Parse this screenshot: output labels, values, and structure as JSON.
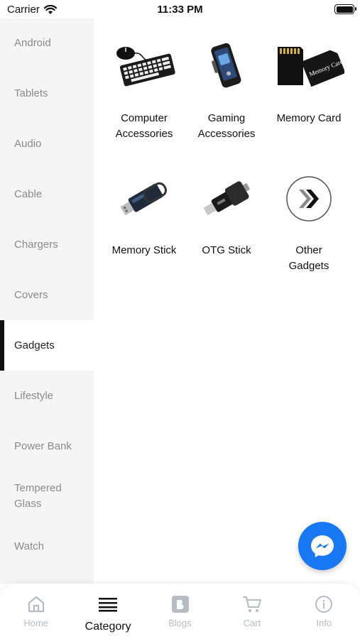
{
  "status_bar": {
    "carrier": "Carrier",
    "time": "11:33 PM"
  },
  "sidebar": {
    "items": [
      {
        "label": "Android",
        "active": false
      },
      {
        "label": "Tablets",
        "active": false
      },
      {
        "label": "Audio",
        "active": false
      },
      {
        "label": "Cable",
        "active": false
      },
      {
        "label": "Chargers",
        "active": false
      },
      {
        "label": "Covers",
        "active": false
      },
      {
        "label": "Gadgets",
        "active": true
      },
      {
        "label": "Lifestyle",
        "active": false
      },
      {
        "label": "Power Bank",
        "active": false
      },
      {
        "label": "Tempered Glass",
        "active": false
      },
      {
        "label": "Watch",
        "active": false
      }
    ]
  },
  "subcategories": [
    {
      "label": "Computer Accessories",
      "icon": "keyboard-mouse-image"
    },
    {
      "label": "Gaming Accessories",
      "icon": "gaming-phone-image"
    },
    {
      "label": "Memory Card",
      "icon": "memory-card-image",
      "image_text": "Memory Card"
    },
    {
      "label": "Memory Stick",
      "icon": "usb-stick-image"
    },
    {
      "label": "OTG Stick",
      "icon": "otg-stick-image"
    },
    {
      "label": "Other Gadgets",
      "icon": "double-chevron-image"
    }
  ],
  "messenger": {
    "icon": "messenger-icon",
    "color": "#1877f2"
  },
  "bottom_nav": {
    "items": [
      {
        "label": "Home",
        "icon": "home-icon",
        "active": false
      },
      {
        "label": "Category",
        "icon": "menu-lines-icon",
        "active": true
      },
      {
        "label": "Blogs",
        "icon": "blog-icon",
        "active": false
      },
      {
        "label": "Cart",
        "icon": "cart-icon",
        "active": false
      },
      {
        "label": "Info",
        "icon": "info-icon",
        "active": false
      }
    ]
  },
  "colors": {
    "accent": "#111111",
    "inactive": "#b6bcc6",
    "sidebar_bg": "#f5f5f5"
  }
}
